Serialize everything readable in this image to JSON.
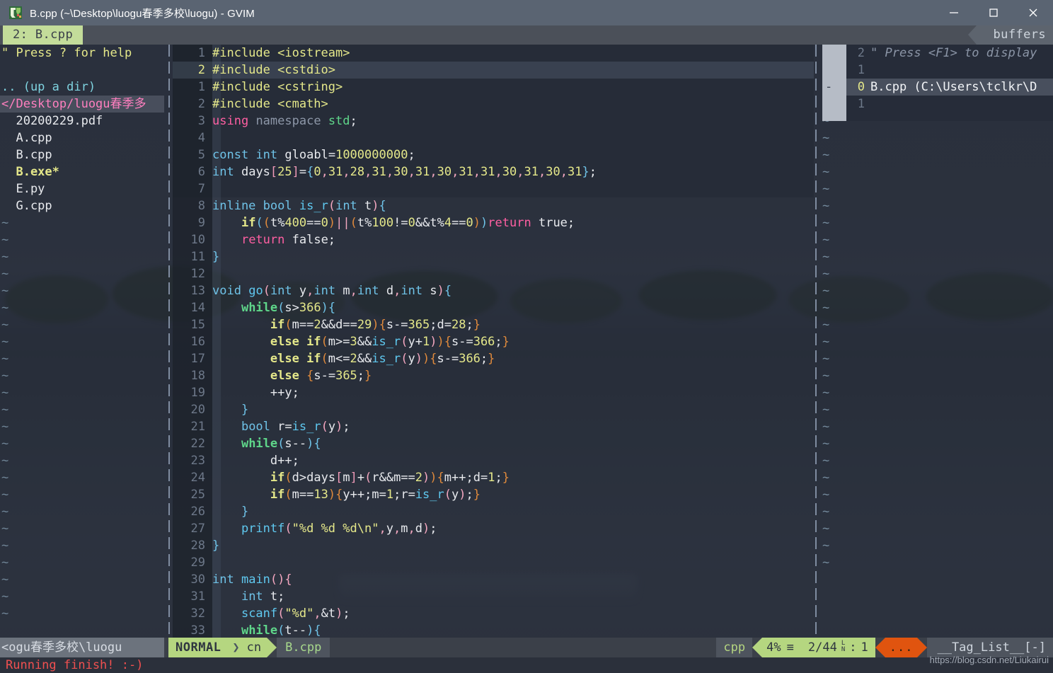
{
  "window": {
    "title": "B.cpp (~\\Desktop\\luogu春季多校\\luogu) - GVIM",
    "app_icon": "gvim-icon",
    "minimize_label": "Minimize",
    "maximize_label": "Maximize",
    "close_label": "Close"
  },
  "tabbar": {
    "active_tab": "2: B.cpp",
    "right_label": "buffers"
  },
  "nerdtree": {
    "lines": [
      {
        "text": "\" Press ? for help",
        "cls": "nt-help"
      },
      {
        "text": "",
        "cls": "nt-file"
      },
      {
        "text": ".. (up a dir)",
        "cls": "nt-up"
      },
      {
        "text": "</Desktop/luogu春季多",
        "cls": "nt-dirsel"
      },
      {
        "text": "  20200229.pdf",
        "cls": "nt-file"
      },
      {
        "text": "  A.cpp",
        "cls": "nt-file"
      },
      {
        "text": "  B.cpp",
        "cls": "nt-file"
      },
      {
        "text": "  B.exe*",
        "cls": "nt-exe"
      },
      {
        "text": "  E.py",
        "cls": "nt-file"
      },
      {
        "text": "  G.cpp",
        "cls": "nt-file"
      }
    ],
    "tilde": "~",
    "tilde_count": 24
  },
  "editor": {
    "cursor_row_index": 1,
    "rows": [
      {
        "num": "1",
        "code_html": "<span class=\"s-pre\">#include &lt;iostream&gt;</span>"
      },
      {
        "num": "2",
        "code_html": "<span class=\"s-pre\">#include &lt;cstdio&gt;</span>"
      },
      {
        "num": "1",
        "code_html": "<span class=\"s-pre\">#include &lt;cstring&gt;</span>"
      },
      {
        "num": "2",
        "code_html": "<span class=\"s-pre\">#include &lt;cmath&gt;</span>"
      },
      {
        "num": "3",
        "code_html": "<span class=\"s-kw\">using</span> <span class=\"s-ns\">namespace</span> <span class=\"s-std\">std</span><span class=\"s-op\">;</span>"
      },
      {
        "num": "4",
        "code_html": ""
      },
      {
        "num": "5",
        "code_html": "<span class=\"s-type\">const</span> <span class=\"s-type\">int</span> <span class=\"s-id\">gloabl</span><span class=\"s-op\">=</span><span class=\"s-num\">1000000000</span><span class=\"s-op\">;</span>"
      },
      {
        "num": "6",
        "code_html": "<span class=\"s-type\">int</span> <span class=\"s-id\">days</span><span class=\"s-brk\">[</span><span class=\"s-num\">25</span><span class=\"s-brk\">]</span><span class=\"s-op\">=</span><span class=\"s-paren3\">{</span><span class=\"s-num\">0</span><span class=\"s-paren\">,</span><span class=\"s-num\">31</span><span class=\"s-paren\">,</span><span class=\"s-num\">28</span><span class=\"s-paren\">,</span><span class=\"s-num\">31</span><span class=\"s-paren\">,</span><span class=\"s-num\">30</span><span class=\"s-paren\">,</span><span class=\"s-num\">31</span><span class=\"s-paren\">,</span><span class=\"s-num\">30</span><span class=\"s-paren\">,</span><span class=\"s-num\">31</span><span class=\"s-paren\">,</span><span class=\"s-num\">31</span><span class=\"s-paren\">,</span><span class=\"s-num\">30</span><span class=\"s-paren\">,</span><span class=\"s-num\">31</span><span class=\"s-paren\">,</span><span class=\"s-num\">30</span><span class=\"s-paren\">,</span><span class=\"s-num\">31</span><span class=\"s-paren3\">}</span><span class=\"s-op\">;</span>"
      },
      {
        "num": "7",
        "code_html": ""
      },
      {
        "num": "8",
        "code_html": "<span class=\"s-type\">inline</span> <span class=\"s-type\">bool</span> <span class=\"s-func\">is_r</span><span class=\"s-paren\">(</span><span class=\"s-type\">int</span> <span class=\"s-id\">t</span><span class=\"s-paren\">)</span><span class=\"s-paren3\">{</span>"
      },
      {
        "num": "9",
        "code_html": "    <span class=\"s-cond\">if</span><span class=\"s-paren3\">(</span><span class=\"s-paren2\">(</span><span class=\"s-id\">t</span><span class=\"s-op\">%</span><span class=\"s-num\">400</span><span class=\"s-op\">==</span><span class=\"s-num\">0</span><span class=\"s-paren2\">)</span><span class=\"s-paren\">||</span><span class=\"s-paren2\">(</span><span class=\"s-id\">t</span><span class=\"s-op\">%</span><span class=\"s-num\">100</span><span class=\"s-op\">!=</span><span class=\"s-num\">0</span><span class=\"s-op\">&amp;&amp;</span><span class=\"s-id\">t</span><span class=\"s-op\">%</span><span class=\"s-num\">4</span><span class=\"s-op\">==</span><span class=\"s-num\">0</span><span class=\"s-paren2\">)</span><span class=\"s-paren3\">)</span><span class=\"s-kw\">return</span> <span class=\"s-op\">true;</span>"
      },
      {
        "num": "10",
        "code_html": "    <span class=\"s-kw\">return</span> <span class=\"s-op\">false;</span>"
      },
      {
        "num": "11",
        "code_html": "<span class=\"s-paren3\">}</span>"
      },
      {
        "num": "12",
        "code_html": ""
      },
      {
        "num": "13",
        "code_html": "<span class=\"s-type\">void</span> <span class=\"s-func\">go</span><span class=\"s-paren\">(</span><span class=\"s-type\">int</span> <span class=\"s-id\">y</span><span class=\"s-paren\">,</span><span class=\"s-type\">int</span> <span class=\"s-id\">m</span><span class=\"s-paren\">,</span><span class=\"s-type\">int</span> <span class=\"s-id\">d</span><span class=\"s-paren\">,</span><span class=\"s-type\">int</span> <span class=\"s-id\">s</span><span class=\"s-paren\">)</span><span class=\"s-paren3\">{</span>"
      },
      {
        "num": "14",
        "code_html": "    <span class=\"s-loop\">while</span><span class=\"s-paren3\">(</span><span class=\"s-id\">s</span><span class=\"s-op\">&gt;</span><span class=\"s-num\">366</span><span class=\"s-paren3\">)</span><span class=\"s-paren3\">{</span>"
      },
      {
        "num": "15",
        "code_html": "        <span class=\"s-cond\">if</span><span class=\"s-paren2\">(</span><span class=\"s-id\">m</span><span class=\"s-op\">==</span><span class=\"s-num\">2</span><span class=\"s-op\">&amp;&amp;</span><span class=\"s-id\">d</span><span class=\"s-op\">==</span><span class=\"s-num\">29</span><span class=\"s-paren2\">)</span><span class=\"s-paren2\">{</span><span class=\"s-id\">s</span><span class=\"s-op\">-=</span><span class=\"s-num\">365</span><span class=\"s-op\">;</span><span class=\"s-id\">d</span><span class=\"s-op\">=</span><span class=\"s-num\">28</span><span class=\"s-op\">;</span><span class=\"s-paren2\">}</span>"
      },
      {
        "num": "16",
        "code_html": "        <span class=\"s-cond\">else if</span><span class=\"s-paren2\">(</span><span class=\"s-id\">m</span><span class=\"s-op\">&gt;=</span><span class=\"s-num\">3</span><span class=\"s-op\">&amp;&amp;</span><span class=\"s-func\">is_r</span><span class=\"s-paren\">(</span><span class=\"s-id\">y</span><span class=\"s-op\">+</span><span class=\"s-num\">1</span><span class=\"s-paren\">)</span><span class=\"s-paren2\">)</span><span class=\"s-paren2\">{</span><span class=\"s-id\">s</span><span class=\"s-op\">-=</span><span class=\"s-num\">366</span><span class=\"s-op\">;</span><span class=\"s-paren2\">}</span>"
      },
      {
        "num": "17",
        "code_html": "        <span class=\"s-cond\">else if</span><span class=\"s-paren2\">(</span><span class=\"s-id\">m</span><span class=\"s-op\">&lt;=</span><span class=\"s-num\">2</span><span class=\"s-op\">&amp;&amp;</span><span class=\"s-func\">is_r</span><span class=\"s-paren\">(</span><span class=\"s-id\">y</span><span class=\"s-paren\">)</span><span class=\"s-paren2\">)</span><span class=\"s-paren2\">{</span><span class=\"s-id\">s</span><span class=\"s-op\">-=</span><span class=\"s-num\">366</span><span class=\"s-op\">;</span><span class=\"s-paren2\">}</span>"
      },
      {
        "num": "18",
        "code_html": "        <span class=\"s-cond\">else</span> <span class=\"s-paren2\">{</span><span class=\"s-id\">s</span><span class=\"s-op\">-=</span><span class=\"s-num\">365</span><span class=\"s-op\">;</span><span class=\"s-paren2\">}</span>"
      },
      {
        "num": "19",
        "code_html": "        <span class=\"s-op\">++</span><span class=\"s-id\">y</span><span class=\"s-op\">;</span>"
      },
      {
        "num": "20",
        "code_html": "    <span class=\"s-paren3\">}</span>"
      },
      {
        "num": "21",
        "code_html": "    <span class=\"s-type\">bool</span> <span class=\"s-id\">r</span><span class=\"s-op\">=</span><span class=\"s-func\">is_r</span><span class=\"s-paren\">(</span><span class=\"s-id\">y</span><span class=\"s-paren\">)</span><span class=\"s-op\">;</span>"
      },
      {
        "num": "22",
        "code_html": "    <span class=\"s-loop\">while</span><span class=\"s-paren3\">(</span><span class=\"s-id\">s</span><span class=\"s-op\">--</span><span class=\"s-paren3\">)</span><span class=\"s-paren3\">{</span>"
      },
      {
        "num": "23",
        "code_html": "        <span class=\"s-id\">d</span><span class=\"s-op\">++;</span>"
      },
      {
        "num": "24",
        "code_html": "        <span class=\"s-cond\">if</span><span class=\"s-paren2\">(</span><span class=\"s-id\">d</span><span class=\"s-op\">&gt;</span><span class=\"s-id\">days</span><span class=\"s-brk\">[</span><span class=\"s-id\">m</span><span class=\"s-brk\">]</span><span class=\"s-op\">+</span><span class=\"s-paren\">(</span><span class=\"s-id\">r</span><span class=\"s-op\">&amp;&amp;</span><span class=\"s-id\">m</span><span class=\"s-op\">==</span><span class=\"s-num\">2</span><span class=\"s-paren\">)</span><span class=\"s-paren2\">)</span><span class=\"s-paren2\">{</span><span class=\"s-id\">m</span><span class=\"s-op\">++;</span><span class=\"s-id\">d</span><span class=\"s-op\">=</span><span class=\"s-num\">1</span><span class=\"s-op\">;</span><span class=\"s-paren2\">}</span>"
      },
      {
        "num": "25",
        "code_html": "        <span class=\"s-cond\">if</span><span class=\"s-paren2\">(</span><span class=\"s-id\">m</span><span class=\"s-op\">==</span><span class=\"s-num\">13</span><span class=\"s-paren2\">)</span><span class=\"s-paren2\">{</span><span class=\"s-id\">y</span><span class=\"s-op\">++;</span><span class=\"s-id\">m</span><span class=\"s-op\">=</span><span class=\"s-num\">1</span><span class=\"s-op\">;</span><span class=\"s-id\">r</span><span class=\"s-op\">=</span><span class=\"s-func\">is_r</span><span class=\"s-paren\">(</span><span class=\"s-id\">y</span><span class=\"s-paren\">)</span><span class=\"s-op\">;</span><span class=\"s-paren2\">}</span>"
      },
      {
        "num": "26",
        "code_html": "    <span class=\"s-paren3\">}</span>"
      },
      {
        "num": "27",
        "code_html": "    <span class=\"s-func\">printf</span><span class=\"s-paren\">(</span><span class=\"s-str\">\"%d %d %d\\n\"</span><span class=\"s-paren\">,</span><span class=\"s-id\">y</span><span class=\"s-paren\">,</span><span class=\"s-id\">m</span><span class=\"s-paren\">,</span><span class=\"s-id\">d</span><span class=\"s-paren\">)</span><span class=\"s-op\">;</span>"
      },
      {
        "num": "28",
        "code_html": "<span class=\"s-paren3\">}</span>"
      },
      {
        "num": "29",
        "code_html": ""
      },
      {
        "num": "30",
        "code_html": "<span class=\"s-type\">int</span> <span class=\"s-func\">main</span><span class=\"s-paren\">()</span><span class=\"s-paren\">{</span>"
      },
      {
        "num": "31",
        "code_html": "    <span class=\"s-type\">int</span> <span class=\"s-id\">t</span><span class=\"s-op\">;</span>"
      },
      {
        "num": "32",
        "code_html": "    <span class=\"s-func\">scanf</span><span class=\"s-paren\">(</span><span class=\"s-str\">\"%d\"</span><span class=\"s-paren\">,</span><span class=\"s-op\">&amp;</span><span class=\"s-id\">t</span><span class=\"s-paren\">)</span><span class=\"s-op\">;</span>"
      },
      {
        "num": "33",
        "code_html": "    <span class=\"s-loop\">while</span><span class=\"s-paren3\">(</span><span class=\"s-id\">t</span><span class=\"s-op\">--</span><span class=\"s-paren3\">)</span><span class=\"s-paren3\">{</span>"
      }
    ]
  },
  "buffers_pane": {
    "rows": [
      {
        "num": "2",
        "text": "\" Press <F1> to display",
        "cls": "rp-comment",
        "highlight": false
      },
      {
        "num": "1",
        "text": "",
        "cls": "rp-buf",
        "highlight": false
      },
      {
        "num": "0",
        "text": "B.cpp (C:\\Users\\tclkr\\D",
        "cls": "rp-buf",
        "highlight": true,
        "current": true
      },
      {
        "num": "1",
        "text": "",
        "cls": "rp-buf",
        "highlight": false
      }
    ],
    "fold_marker": "-",
    "tilde": "~",
    "tilde_count": 29
  },
  "statusline": {
    "left_path": "<ogu春季多校\\luogu",
    "mode": "NORMAL",
    "mode_sep": "❯",
    "encoding": "cn",
    "filename": "B.cpp",
    "filetype": "cpp",
    "percent": "4%",
    "percent_icon": "≡",
    "line_pos": "2/44",
    "ln_top": "L",
    "ln_bottom": "N",
    "colon": ":",
    "column": "1",
    "dots": "...",
    "taglist": "__Tag_List__[-]"
  },
  "cmdline": {
    "message": "Running finish! :-)"
  },
  "watermark": {
    "text": "https://blog.csdn.net/Liukairui"
  },
  "colors": {
    "titlebar": "#5a6472",
    "tab_active_bg": "#c3dc9a",
    "status_green": "#b5d680",
    "status_orange": "#e0540f",
    "editor_bg": "#2e3440",
    "cmd_red": "#f05050"
  }
}
